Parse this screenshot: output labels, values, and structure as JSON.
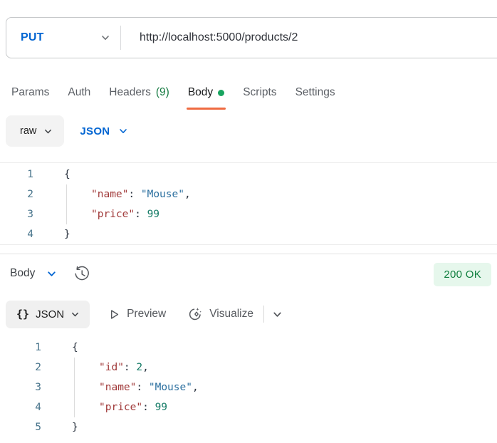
{
  "request_bar": {
    "method": "PUT",
    "url": "http://localhost:5000/products/2"
  },
  "tabs": [
    {
      "label": "Params"
    },
    {
      "label": "Auth"
    },
    {
      "label": "Headers",
      "count": "(9)"
    },
    {
      "label": "Body"
    },
    {
      "label": "Scripts"
    },
    {
      "label": "Settings"
    }
  ],
  "body_toolbar": {
    "format": "raw",
    "language": "JSON"
  },
  "request_editor": {
    "lines": [
      {
        "num": "1",
        "open": "{"
      },
      {
        "num": "2",
        "key": "\"name\"",
        "colon": ": ",
        "str": "\"Mouse\"",
        "comma": ","
      },
      {
        "num": "3",
        "key": "\"price\"",
        "colon": ": ",
        "number": "99"
      },
      {
        "num": "4",
        "close": "}"
      }
    ]
  },
  "response": {
    "section_label": "Body",
    "status": "200 OK",
    "toolbar": {
      "braces_icon": "{}",
      "format_label": "JSON",
      "preview_label": "Preview",
      "visualize_label": "Visualize"
    },
    "editor": {
      "lines": [
        {
          "num": "1",
          "open": "{"
        },
        {
          "num": "2",
          "key": "\"id\"",
          "colon": ": ",
          "number": "2",
          "comma": ","
        },
        {
          "num": "3",
          "key": "\"name\"",
          "colon": ": ",
          "str": "\"Mouse\"",
          "comma": ","
        },
        {
          "num": "4",
          "key": "\"price\"",
          "colon": ": ",
          "number": "99"
        },
        {
          "num": "5",
          "close": "}"
        }
      ]
    }
  },
  "colors": {
    "method_blue": "#0265d2",
    "accent_orange": "#ef6b41",
    "success_green": "#0f7e3d",
    "success_bg": "#e6f7ec",
    "headers_count_green": "#187c44",
    "body_dot_green": "#18a45f",
    "token_key": "#a13b3b",
    "token_string": "#2b6f9f",
    "token_number": "#167c67",
    "line_number": "#49758c"
  }
}
